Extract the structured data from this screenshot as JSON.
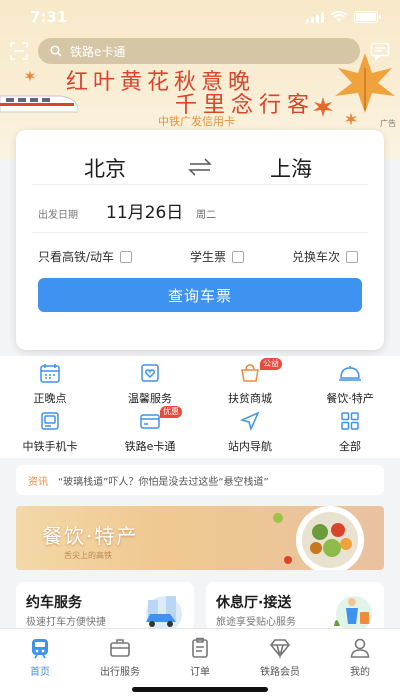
{
  "status_bar": {
    "time": "7:31",
    "icons": [
      "signal-icon",
      "wifi-icon",
      "battery-icon"
    ]
  },
  "search": {
    "placeholder": "铁路e卡通"
  },
  "banner": {
    "line1": "红叶黄花秋意晚",
    "line2": "千里念行客",
    "sponsor": "中铁广发信用卡",
    "ad_tag": "广告"
  },
  "booking": {
    "from_city": "北京",
    "to_city": "上海",
    "date_label": "出发日期",
    "date_value": "11月26日",
    "weekday": "周二",
    "options": [
      {
        "label": "只看高铁/动车",
        "checked": false
      },
      {
        "label": "学生票",
        "checked": false
      },
      {
        "label": "兑换车次",
        "checked": false
      }
    ],
    "query_label": "查询车票"
  },
  "services": [
    {
      "label": "正晚点",
      "icon": "calendar-clock-icon",
      "badge": ""
    },
    {
      "label": "温馨服务",
      "icon": "heart-card-icon",
      "badge": ""
    },
    {
      "label": "扶贫商城",
      "icon": "shop-icon",
      "badge": "公益"
    },
    {
      "label": "餐饮·特产",
      "icon": "food-cover-icon",
      "badge": ""
    },
    {
      "label": "中铁手机卡",
      "icon": "sim-card-icon",
      "badge": ""
    },
    {
      "label": "铁路e卡通",
      "icon": "wallet-card-icon",
      "badge": "优惠"
    },
    {
      "label": "站内导航",
      "icon": "navigation-icon",
      "badge": ""
    },
    {
      "label": "全部",
      "icon": "grid-icon",
      "badge": ""
    }
  ],
  "news": {
    "tag": "资讯",
    "text": "“玻璃栈道”吓人？你怕是没去过这些“悬空栈道”"
  },
  "food_banner": {
    "title": "餐饮·特产",
    "subtitle": "舌尖上的高铁"
  },
  "service_cards": [
    {
      "title": "约车服务",
      "subtitle": "极速打车方便快捷"
    },
    {
      "title": "休息厅·接送",
      "subtitle": "旅途享受贴心服务"
    }
  ],
  "tabbar": [
    {
      "label": "首页",
      "icon": "train-icon",
      "active": true
    },
    {
      "label": "出行服务",
      "icon": "briefcase-icon",
      "active": false
    },
    {
      "label": "订单",
      "icon": "order-list-icon",
      "active": false
    },
    {
      "label": "铁路会员",
      "icon": "diamond-icon",
      "active": false
    },
    {
      "label": "我的",
      "icon": "user-icon",
      "active": false
    }
  ],
  "colors": {
    "accent": "#3e92f0",
    "banner_red": "#d8452b",
    "badge_red": "#e94a3c",
    "news_tag": "#f08a3c"
  }
}
